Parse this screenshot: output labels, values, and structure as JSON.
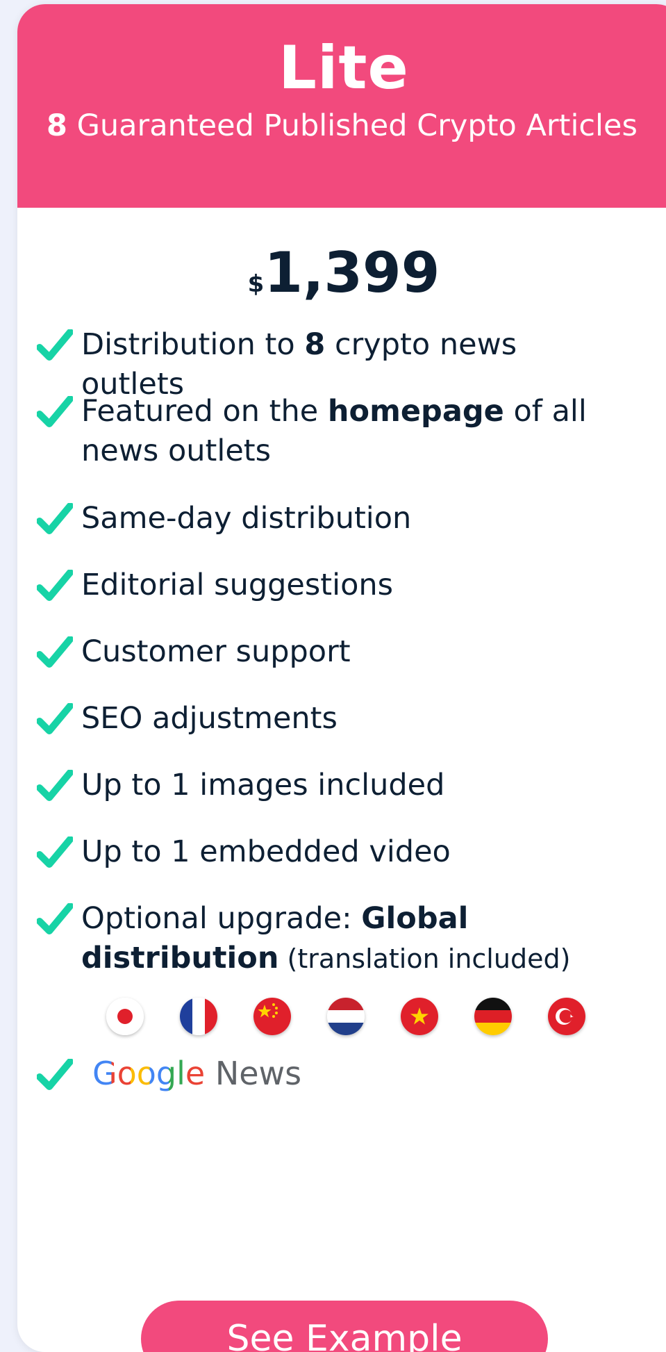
{
  "plan": {
    "name": "Lite",
    "subtitle_count": "8",
    "subtitle_text": " Guaranteed Published Crypto Articles"
  },
  "price": {
    "currency": "$",
    "amount": "1,399"
  },
  "features": [
    {
      "pre": "Distribution to ",
      "bold": "8",
      "post": " crypto news outlets"
    },
    {
      "pre": "Featured on the ",
      "bold": "homepage",
      "post": " of all news outlets"
    },
    {
      "text": "Same-day distribution"
    },
    {
      "text": "Editorial suggestions"
    },
    {
      "text": "Customer support"
    },
    {
      "text": "SEO adjustments"
    },
    {
      "text": "Up to 1 images included"
    },
    {
      "text": "Up to 1 embedded video"
    },
    {
      "pre": "Optional upgrade: ",
      "bold": "Global distribution",
      "small": " (translation included)"
    }
  ],
  "flags": [
    "japan-flag-icon",
    "france-flag-icon",
    "china-flag-icon",
    "netherlands-flag-icon",
    "vietnam-flag-icon",
    "germany-flag-icon",
    "turkey-flag-icon"
  ],
  "google_news": {
    "google": "Google",
    "news": " News"
  },
  "cta": {
    "label": "See Example"
  },
  "colors": {
    "accent": "#f24a7d",
    "check": "#17d3a6",
    "text": "#0d1f33"
  }
}
